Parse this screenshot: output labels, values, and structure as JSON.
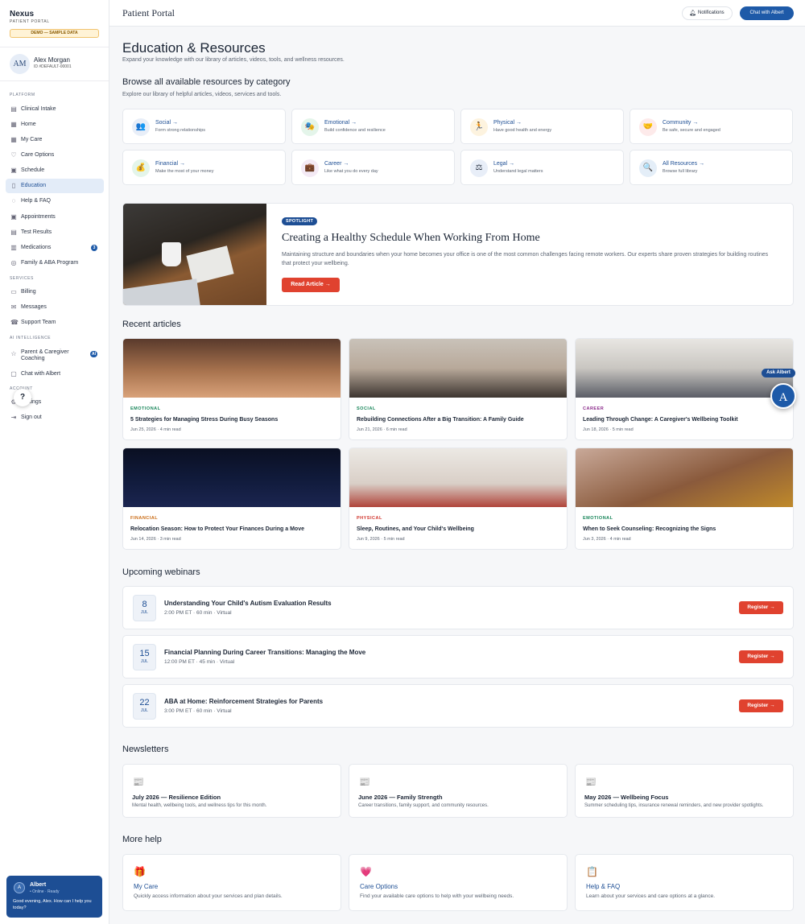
{
  "sidebar": {
    "brand": "Nexus",
    "brand_sub": "PATIENT PORTAL",
    "demo_badge": "DEMO — SAMPLE DATA",
    "user": {
      "initials": "AM",
      "name": "Alex Morgan",
      "id": "ID #DEFAULT-00001"
    },
    "sections": {
      "platform": "PLATFORM",
      "services": "SERVICES",
      "ai": "AI INTELLIGENCE",
      "account": "ACCOUNT"
    },
    "items": [
      {
        "label": "Clinical Intake",
        "icon": "clipboard-icon"
      },
      {
        "label": "Home",
        "icon": "grid-icon"
      },
      {
        "label": "My Care",
        "icon": "grid-icon"
      },
      {
        "label": "Care Options",
        "icon": "heart-icon"
      },
      {
        "label": "Schedule",
        "icon": "calendar-icon"
      },
      {
        "label": "Education",
        "icon": "book-icon",
        "active": true
      },
      {
        "label": "Help & FAQ",
        "icon": "help-icon"
      },
      {
        "label": "Appointments",
        "icon": "calendar-icon"
      },
      {
        "label": "Test Results",
        "icon": "document-icon"
      },
      {
        "label": "Medications",
        "icon": "pill-icon",
        "badge": "3"
      },
      {
        "label": "Family & ABA Program",
        "icon": "location-icon"
      },
      {
        "label": "Billing",
        "icon": "card-icon"
      },
      {
        "label": "Messages",
        "icon": "mail-icon"
      },
      {
        "label": "Support Team",
        "icon": "phone-icon"
      },
      {
        "label": "Parent & Caregiver Coaching",
        "icon": "star-icon",
        "badge": "AI"
      },
      {
        "label": "Chat with Albert",
        "icon": "chat-icon"
      },
      {
        "label": "Settings",
        "icon": "gear-icon"
      },
      {
        "label": "Sign out",
        "icon": "signout-icon"
      }
    ],
    "help_fab": "?",
    "chat": {
      "initial": "A",
      "name": "Albert",
      "status": "• Online · Ready",
      "message": "Good evening, Alex. How can I help you today?"
    }
  },
  "topbar": {
    "title": "Patient Portal",
    "notifications": "Notifications",
    "chat_button": "Chat with Albert"
  },
  "page": {
    "title": "Education & Resources",
    "subtitle": "Expand your knowledge with our library of articles, videos, tools, and wellness resources.",
    "browse_title": "Browse all available resources by category",
    "browse_subtitle": "Explore our library of helpful articles, videos, services and tools."
  },
  "categories": [
    {
      "label": "Social →",
      "desc": "Form strong relationships",
      "icon": "people-icon",
      "glyph": "👥",
      "bg": "#e8eef8"
    },
    {
      "label": "Emotional →",
      "desc": "Build confidence and resilience",
      "icon": "emotional-icon",
      "glyph": "🎭",
      "bg": "#e4f5ea"
    },
    {
      "label": "Physical →",
      "desc": "Have good health and energy",
      "icon": "runner-icon",
      "glyph": "🏃",
      "bg": "#fdf3df"
    },
    {
      "label": "Community →",
      "desc": "Be safe, secure and engaged",
      "icon": "handshake-icon",
      "glyph": "🤝",
      "bg": "#fdeaea"
    },
    {
      "label": "Financial →",
      "desc": "Make the most of your money",
      "icon": "moneybag-icon",
      "glyph": "💰",
      "bg": "#e4f5ea"
    },
    {
      "label": "Career →",
      "desc": "Like what you do every day",
      "icon": "briefcase-icon",
      "glyph": "💼",
      "bg": "#f4eaf5"
    },
    {
      "label": "Legal →",
      "desc": "Understand legal matters",
      "icon": "scales-icon",
      "glyph": "⚖",
      "bg": "#e8eef8"
    },
    {
      "label": "All Resources →",
      "desc": "Browse full library",
      "icon": "magnifier-icon",
      "glyph": "🔍",
      "bg": "#e4eef8"
    }
  ],
  "spotlight": {
    "tag": "SPOTLIGHT",
    "title": "Creating a Healthy Schedule When Working From Home",
    "desc": "Maintaining structure and boundaries when your home becomes your office is one of the most common challenges facing remote workers. Our experts share proven strategies for building routines that protect your wellbeing.",
    "button": "Read Article →"
  },
  "recent": {
    "heading": "Recent articles",
    "articles": [
      {
        "tag": "EMOTIONAL",
        "tag_color": "#18865a",
        "title": "5 Strategies for Managing Stress During Busy Seasons",
        "meta": "Jun 25, 2026 · 4 min read",
        "bg": "linear-gradient(180deg,#5a3a2c 0%,#a8734e 55%,#d9a27a 100%)"
      },
      {
        "tag": "SOCIAL",
        "tag_color": "#18865a",
        "title": "Rebuilding Connections After a Big Transition: A Family Guide",
        "meta": "Jun 21, 2026 · 6 min read",
        "bg": "linear-gradient(180deg,#c9c2b9 0%,#b8a99a 50%,#3d3530 100%)"
      },
      {
        "tag": "CAREER",
        "tag_color": "#8a2a8a",
        "title": "Leading Through Change: A Caregiver's Wellbeing Toolkit",
        "meta": "Jun 18, 2026 · 5 min read",
        "bg": "linear-gradient(180deg,#e8e6e2 0%,#c9c6c1 50%,#5a5d66 100%)"
      },
      {
        "tag": "FINANCIAL",
        "tag_color": "#c96a12",
        "title": "Relocation Season: How to Protect Your Finances During a Move",
        "meta": "Jun 14, 2026 · 3 min read",
        "bg": "linear-gradient(180deg,#0a0f22 0%,#101a3a 50%,#1b2550 100%)"
      },
      {
        "tag": "PHYSICAL",
        "tag_color": "#d0342c",
        "title": "Sleep, Routines, and Your Child's Wellbeing",
        "meta": "Jun 9, 2026 · 5 min read",
        "bg": "linear-gradient(180deg,#ece9e4 0%,#d9cfc7 60%,#b0443a 100%)"
      },
      {
        "tag": "EMOTIONAL",
        "tag_color": "#18865a",
        "title": "When to Seek Counseling: Recognizing the Signs",
        "meta": "Jun 3, 2026 · 4 min read",
        "bg": "linear-gradient(160deg,#c9a999 0%,#8a5a3c 55%,#c08a2a 100%)"
      }
    ]
  },
  "webinars": {
    "heading": "Upcoming webinars",
    "items": [
      {
        "day": "8",
        "month": "JUL",
        "title": "Understanding Your Child's Autism Evaluation Results",
        "meta": "2:00 PM ET · 60 min · Virtual",
        "button": "Register →"
      },
      {
        "day": "15",
        "month": "JUL",
        "title": "Financial Planning During Career Transitions: Managing the Move",
        "meta": "12:00 PM ET · 45 min · Virtual",
        "button": "Register →"
      },
      {
        "day": "22",
        "month": "JUL",
        "title": "ABA at Home: Reinforcement Strategies for Parents",
        "meta": "3:00 PM ET · 60 min · Virtual",
        "button": "Register →"
      }
    ]
  },
  "newsletters": {
    "heading": "Newsletters",
    "items": [
      {
        "icon": "newspaper-icon",
        "glyph": "📰",
        "title": "July 2026 — Resilience Edition",
        "desc": "Mental health, wellbeing tools, and wellness tips for this month."
      },
      {
        "icon": "newspaper-icon",
        "glyph": "📰",
        "title": "June 2026 — Family Strength",
        "desc": "Career transitions, family support, and community resources."
      },
      {
        "icon": "newspaper-icon",
        "glyph": "📰",
        "title": "May 2026 — Wellbeing Focus",
        "desc": "Summer scheduling tips, insurance renewal reminders, and new provider spotlights."
      }
    ]
  },
  "more_help": {
    "heading": "More help",
    "items": [
      {
        "icon": "gift-icon",
        "glyph": "🎁",
        "title": "My Care",
        "desc": "Quickly access information about your services and plan details."
      },
      {
        "icon": "heart-icon",
        "glyph": "💗",
        "title": "Care Options",
        "desc": "Find your available care options to help with your wellbeing needs."
      },
      {
        "icon": "clipboard-icon",
        "glyph": "📋",
        "title": "Help & FAQ",
        "desc": "Learn about your services and care options at a glance."
      }
    ]
  },
  "ask_albert": {
    "badge": "Ask Albert",
    "initial": "A"
  }
}
